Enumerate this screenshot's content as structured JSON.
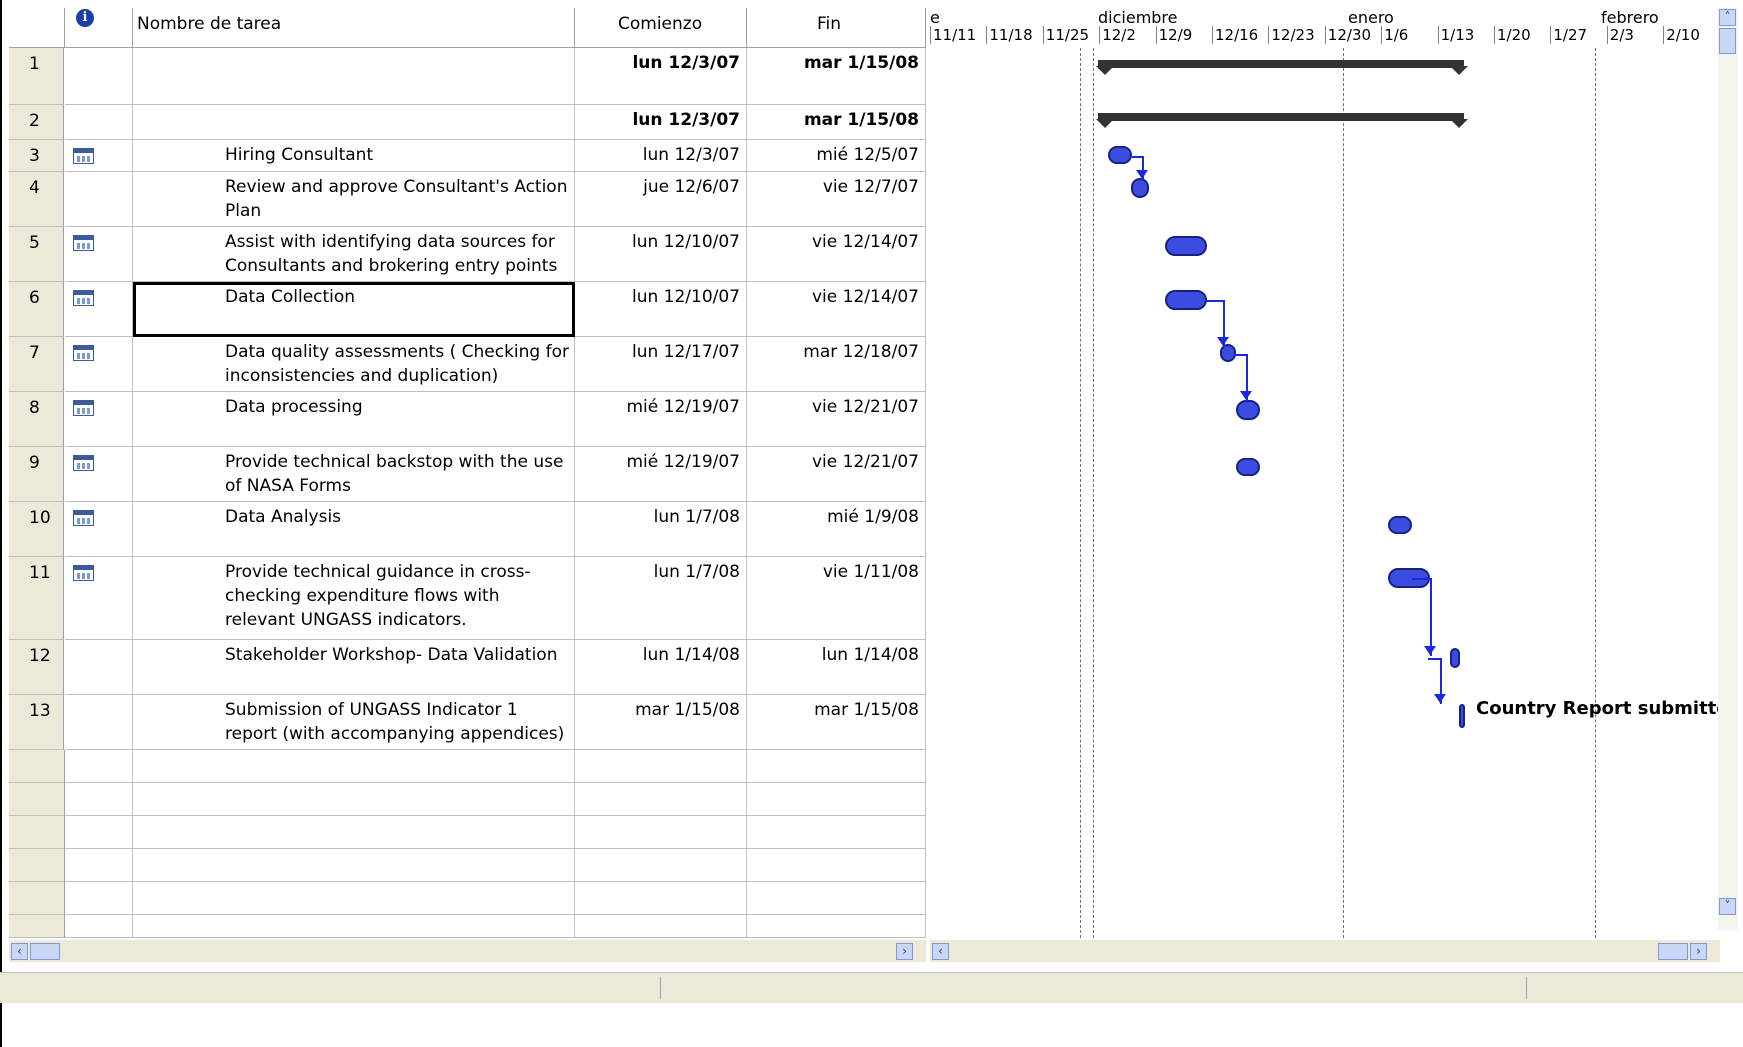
{
  "table": {
    "headers": {
      "info": "i",
      "name": "Nombre de tarea",
      "start": "Comienzo",
      "finish": "Fin"
    },
    "rows": [
      {
        "id": "1",
        "name": "",
        "start": "lun 12/3/07",
        "finish": "mar 1/15/08",
        "bold": true,
        "icon": false
      },
      {
        "id": "2",
        "name": "",
        "start": "lun 12/3/07",
        "finish": "mar 1/15/08",
        "bold": true,
        "icon": false
      },
      {
        "id": "3",
        "name": "Hiring Consultant",
        "start": "lun 12/3/07",
        "finish": "mié 12/5/07",
        "icon": true
      },
      {
        "id": "4",
        "name": "Review and approve Consultant's Action Plan",
        "start": "jue 12/6/07",
        "finish": "vie 12/7/07",
        "icon": false
      },
      {
        "id": "5",
        "name": "Assist with identifying data sources for Consultants and brokering entry points",
        "start": "lun 12/10/07",
        "finish": "vie 12/14/07",
        "icon": true
      },
      {
        "id": "6",
        "name": "Data Collection",
        "start": "lun 12/10/07",
        "finish": "vie 12/14/07",
        "icon": true,
        "selected": true
      },
      {
        "id": "7",
        "name": "Data quality assessments ( Checking for inconsistencies and duplication)",
        "start": "lun 12/17/07",
        "finish": "mar 12/18/07",
        "icon": true
      },
      {
        "id": "8",
        "name": "Data processing",
        "start": "mié 12/19/07",
        "finish": "vie 12/21/07",
        "icon": true
      },
      {
        "id": "9",
        "name": "Provide technical backstop with the use of NASA Forms",
        "start": "mié 12/19/07",
        "finish": "vie 12/21/07",
        "icon": true
      },
      {
        "id": "10",
        "name": "Data Analysis",
        "start": "lun 1/7/08",
        "finish": "mié 1/9/08",
        "icon": true
      },
      {
        "id": "11",
        "name": "Provide technical guidance in cross-checking expenditure flows with relevant UNGASS indicators.",
        "start": "lun 1/7/08",
        "finish": "vie 1/11/08",
        "icon": true
      },
      {
        "id": "12",
        "name": "Stakeholder Workshop- Data Validation",
        "start": "lun 1/14/08",
        "finish": "lun 1/14/08",
        "icon": false
      },
      {
        "id": "13",
        "name": "Submission of UNGASS Indicator 1 report (with accompanying appendices)",
        "start": "mar 1/15/08",
        "finish": "mar 1/15/08",
        "icon": false
      }
    ]
  },
  "gantt": {
    "months": [
      "e",
      "diciembre",
      "enero",
      "febrero"
    ],
    "weeks": [
      "11/11",
      "11/18",
      "11/25",
      "12/2",
      "12/9",
      "12/16",
      "12/23",
      "12/30",
      "1/6",
      "1/13",
      "1/20",
      "1/27",
      "2/3",
      "2/10"
    ],
    "milestone_label": "Country Report submitte"
  },
  "scroll": {
    "left_arrow": "‹",
    "right_arrow": "›",
    "up_arrow": "˄",
    "down_arrow": "˅"
  }
}
